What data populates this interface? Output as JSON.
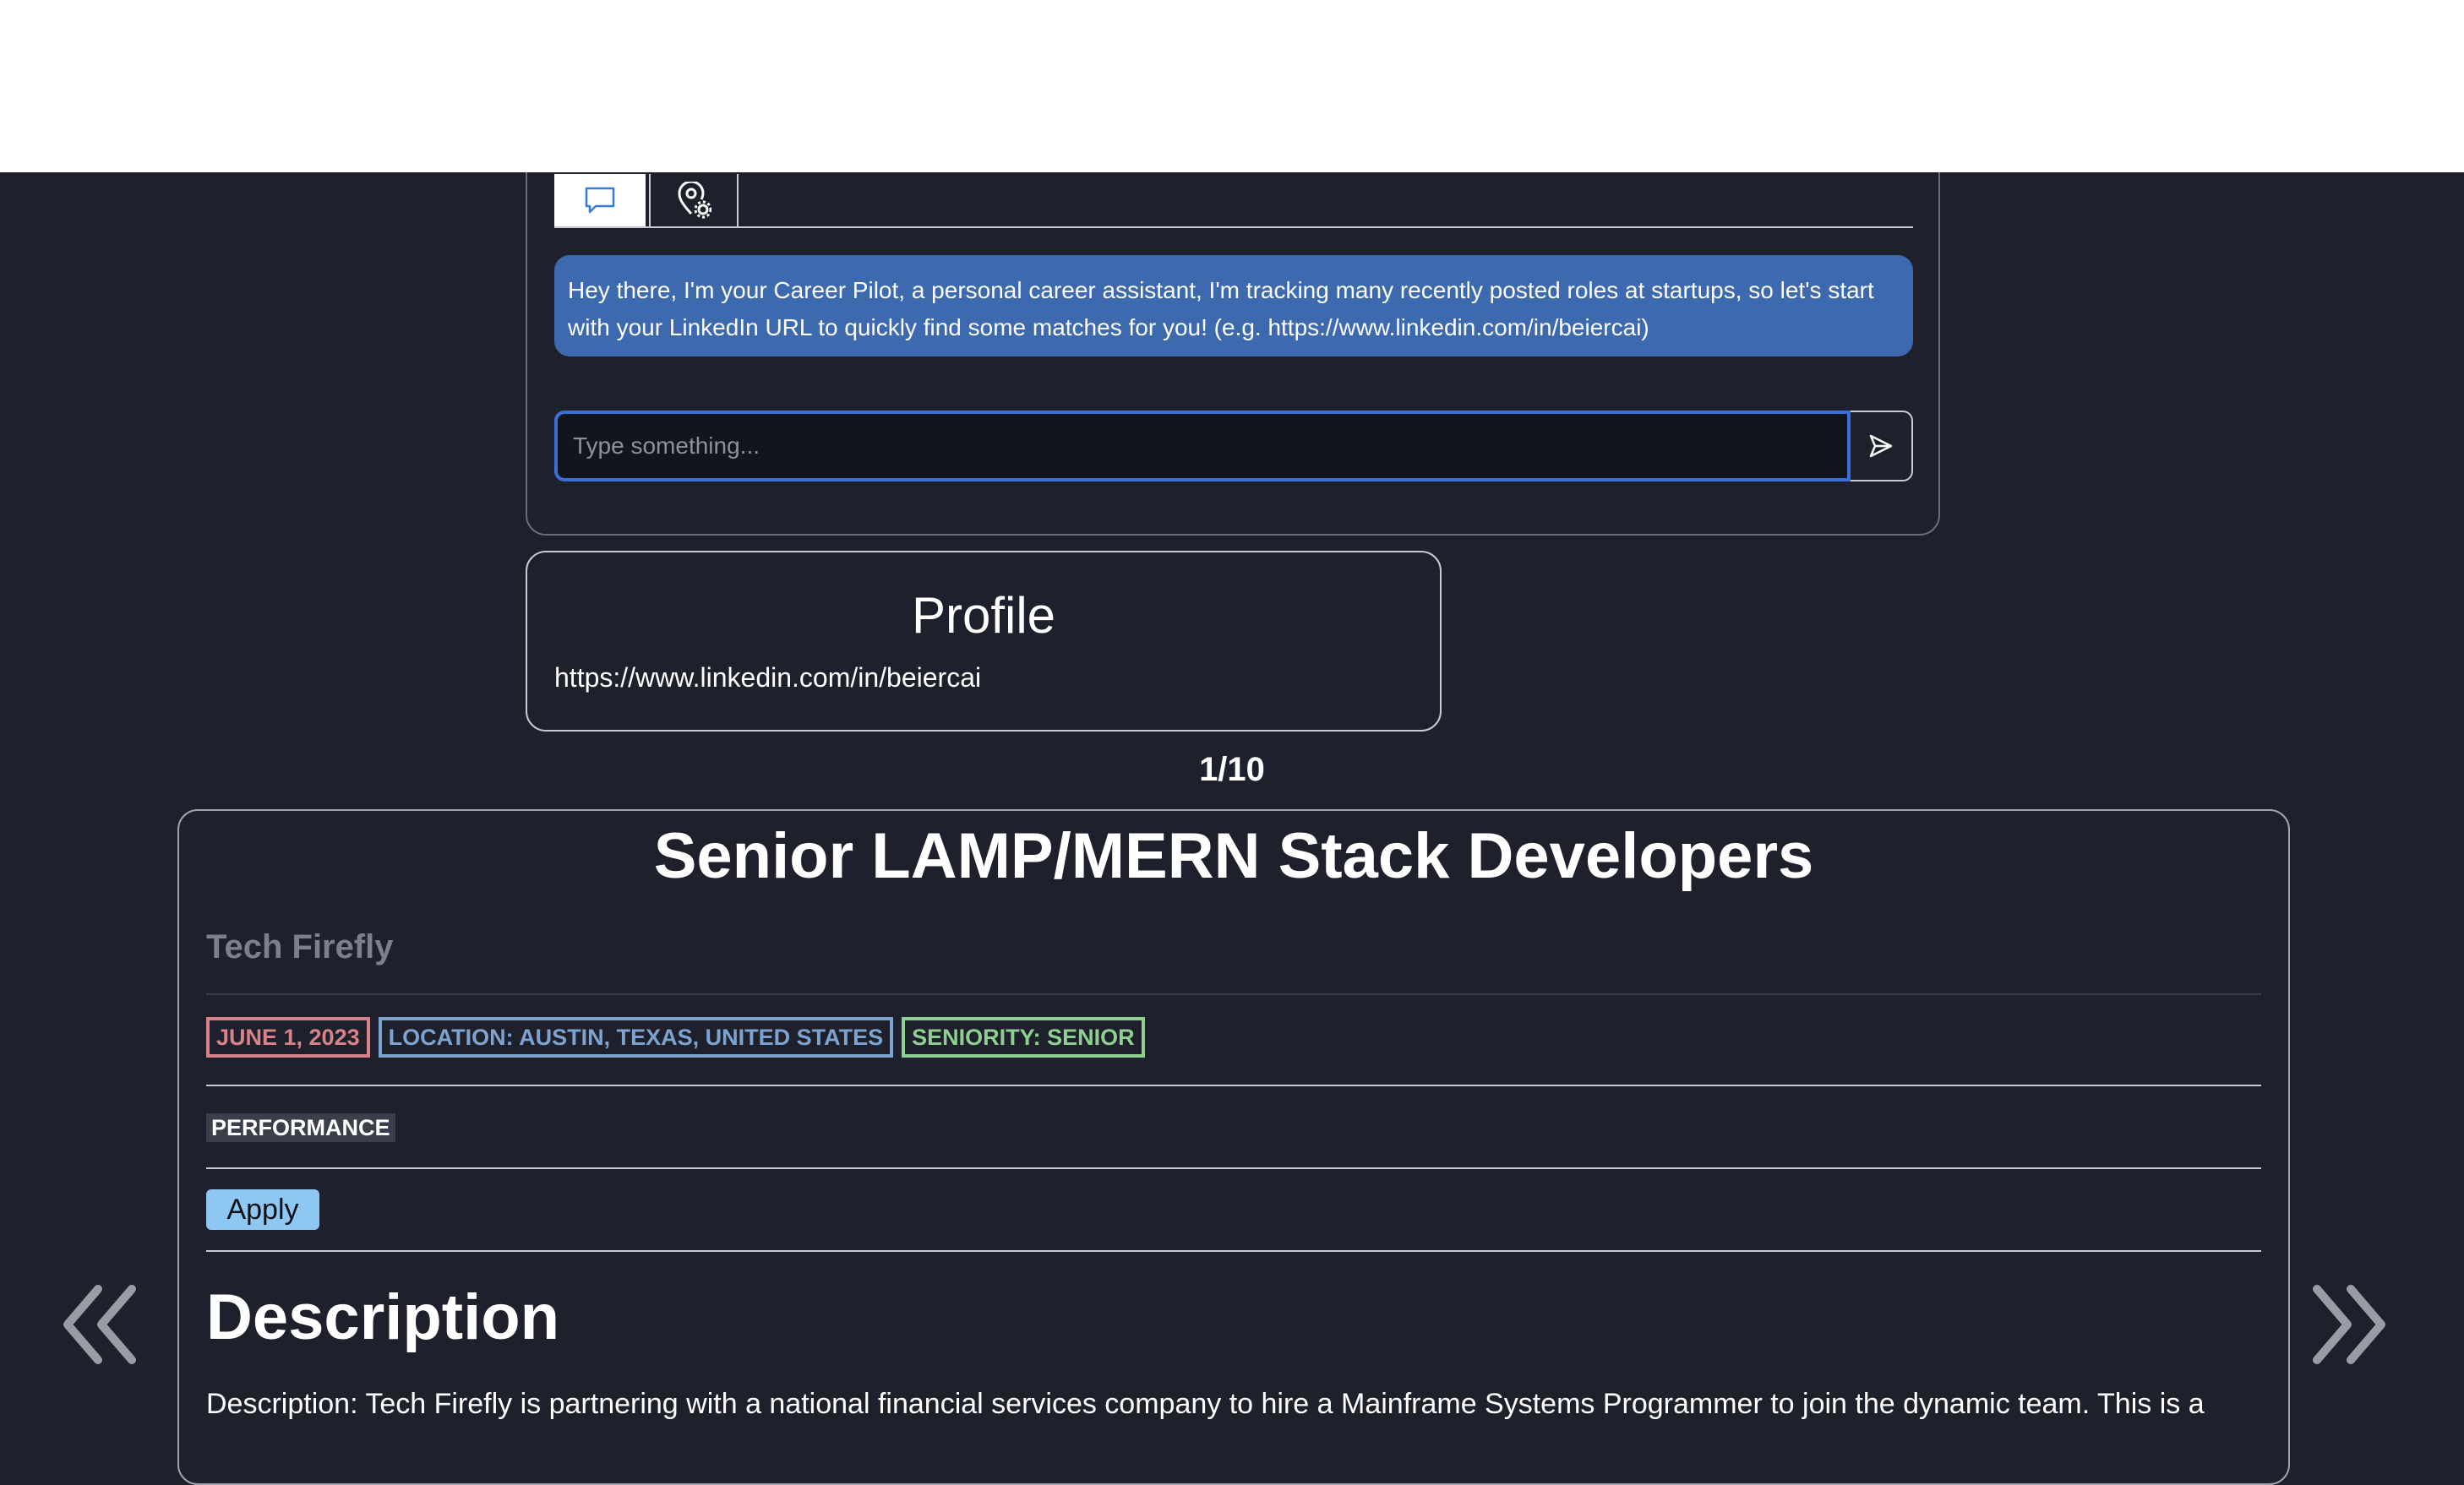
{
  "chat": {
    "tabs": [
      {
        "icon": "chat-bubble-icon"
      },
      {
        "icon": "location-settings-icon"
      }
    ],
    "assistant_message": "Hey there, I'm your Career Pilot, a personal career assistant, I'm tracking many recently posted roles at startups, so let's start with your LinkedIn URL to quickly find some matches for you! (e.g. https://www.linkedin.com/in/beiercai)",
    "input_placeholder": "Type something...",
    "input_value": "",
    "send_icon": "send-icon"
  },
  "profile": {
    "title": "Profile",
    "url": "https://www.linkedin.com/in/beiercai"
  },
  "pager": {
    "counter": "1/10",
    "prev_icon": "double-chevron-left-icon",
    "next_icon": "double-chevron-right-icon"
  },
  "job": {
    "title": "Senior LAMP/MERN Stack Developers",
    "company": "Tech Firefly",
    "badges": {
      "date": "JUNE 1, 2023",
      "location": "LOCATION: AUSTIN, TEXAS, UNITED STATES",
      "seniority": "SENIORITY: SENIOR"
    },
    "tag": "PERFORMANCE",
    "apply_label": "Apply",
    "description_heading": "Description",
    "description_text": "Description: Tech Firefly is partnering with a national financial services company to hire a Mainframe Systems Programmer to join the dynamic team. This is a"
  },
  "colors": {
    "background": "#1e212b",
    "message_bubble": "#3d6aaf",
    "input_focus": "#3a6fd8",
    "date_badge": "#d8838a",
    "location_badge": "#7fa3cf",
    "seniority_badge": "#8fcf92",
    "apply_button": "#8dc7f2",
    "company_text": "#7b8090"
  }
}
